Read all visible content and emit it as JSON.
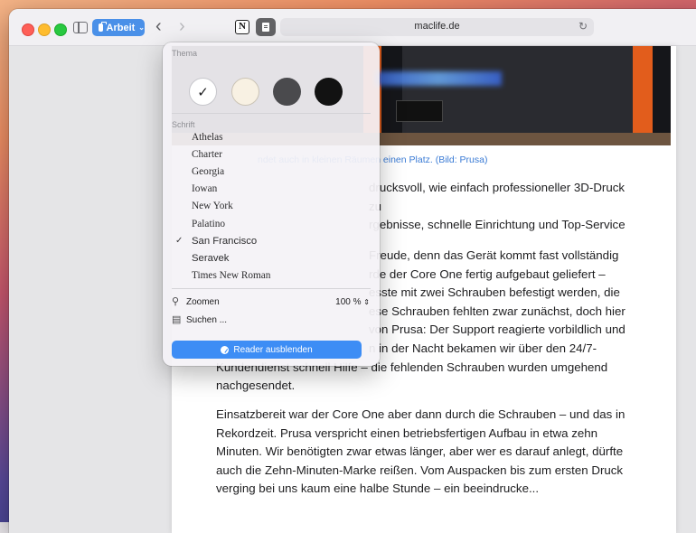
{
  "browser": {
    "tab_group_label": "Arbeit",
    "url": "maclife.de"
  },
  "article": {
    "caption_partial": "ndet auch in kleinen Räumen einen Platz. (Bild: Prusa)",
    "p1_lines": [
      "drucksvoll, wie einfach professioneller 3D-Druck zu",
      "rgebnisse, schnelle Einrichtung und Top-Service"
    ],
    "p2_lines": [
      "Freude, denn das Gerät kommt fast vollständig",
      "rde der Core One fertig aufgebaut geliefert –",
      "esste mit zwei Schrauben befestigt werden, die",
      "ese Schrauben fehlten zwar zunächst, doch hier",
      "von Prusa: Der Support reagierte vorbildlich und",
      "n in der Nacht bekamen wir über den 24/7-",
      "Kundendienst schnell Hilfe – die fehlenden Schrauben wurden umgehend",
      "nachgesendet."
    ],
    "p3_lines": [
      "Einsatzbereit war der Core One aber dann durch die Schrauben – und das in",
      "Rekordzeit. Prusa verspricht einen betriebsfertigen Aufbau in etwa zehn",
      "Minuten. Wir benötigten zwar etwas länger, aber wer es darauf anlegt, dürfte",
      "auch die Zehn-Minuten-Marke reißen. Vom Auspacken bis zum ersten Druck",
      "verging bei uns kaum eine halbe Stunde – ein beeindrucke..."
    ]
  },
  "reader_menu": {
    "theme_label": "Thema",
    "themes": [
      "white",
      "sepia",
      "gray",
      "black"
    ],
    "selected_theme": "white",
    "font_label": "Schrift",
    "fonts": [
      "Athelas",
      "Charter",
      "Georgia",
      "Iowan",
      "New York",
      "Palatino",
      "San Francisco",
      "Seravek",
      "Times New Roman"
    ],
    "selected_font": "San Francisco",
    "zoom_label": "Zoomen",
    "zoom_value": "100 %",
    "search_label": "Suchen ...",
    "hide_reader_label": "Reader ausblenden"
  },
  "colors": {
    "accent": "#3d8df5",
    "tab_group": "#4a90e8",
    "caption_link": "#3a7bd5"
  }
}
